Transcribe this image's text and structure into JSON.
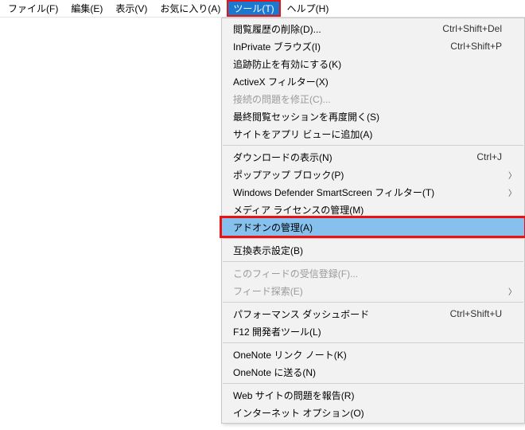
{
  "menubar": {
    "items": [
      {
        "label": "ファイル(F)"
      },
      {
        "label": "編集(E)"
      },
      {
        "label": "表示(V)"
      },
      {
        "label": "お気に入り(A)"
      },
      {
        "label": "ツール(T)",
        "active": true
      },
      {
        "label": "ヘルプ(H)"
      }
    ]
  },
  "dropdown": {
    "groups": [
      [
        {
          "label": "閲覧履歴の削除(D)...",
          "shortcut": "Ctrl+Shift+Del"
        },
        {
          "label": "InPrivate ブラウズ(I)",
          "shortcut": "Ctrl+Shift+P"
        },
        {
          "label": "追跡防止を有効にする(K)"
        },
        {
          "label": "ActiveX フィルター(X)"
        },
        {
          "label": "接続の問題を修正(C)...",
          "disabled": true
        },
        {
          "label": "最終閲覧セッションを再度開く(S)"
        },
        {
          "label": "サイトをアプリ ビューに追加(A)"
        }
      ],
      [
        {
          "label": "ダウンロードの表示(N)",
          "shortcut": "Ctrl+J"
        },
        {
          "label": "ポップアップ ブロック(P)",
          "submenu": true
        },
        {
          "label": "Windows Defender SmartScreen フィルター(T)",
          "submenu": true
        },
        {
          "label": "メディア ライセンスの管理(M)"
        },
        {
          "label": "アドオンの管理(A)",
          "highlighted": true
        }
      ],
      [
        {
          "label": "互換表示設定(B)"
        }
      ],
      [
        {
          "label": "このフィードの受信登録(F)...",
          "disabled": true
        },
        {
          "label": "フィード探索(E)",
          "disabled": true,
          "submenu": true
        }
      ],
      [
        {
          "label": "パフォーマンス ダッシュボード",
          "shortcut": "Ctrl+Shift+U"
        },
        {
          "label": "F12 開発者ツール(L)"
        }
      ],
      [
        {
          "label": "OneNote リンク ノート(K)"
        },
        {
          "label": "OneNote に送る(N)"
        }
      ],
      [
        {
          "label": "Web サイトの問題を報告(R)"
        },
        {
          "label": "インターネット オプション(O)"
        }
      ]
    ]
  },
  "arrow_glyph": "〉"
}
